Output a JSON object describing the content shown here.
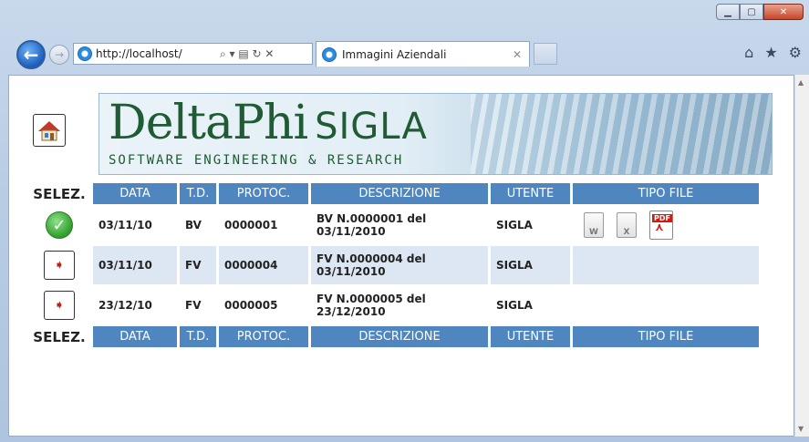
{
  "window": {
    "tab_title": "Immagini Aziendali",
    "address": "http://localhost/",
    "address_tools": "⌕ ▾ ▤ ↻ ✕"
  },
  "banner": {
    "logo_main": "DeltaPhi",
    "logo_sub": "SIGLA",
    "logo_tagline": "SOFTWARE ENGINEERING & RESEARCH"
  },
  "table": {
    "sel_header": "SELEZ.",
    "headers": [
      "DATA",
      "T.D.",
      "PROTOC.",
      "DESCRIZIONE",
      "UTENTE",
      "TIPO FILE"
    ],
    "rows": [
      {
        "data": "03/11/10",
        "td": "BV",
        "protoc": "0000001",
        "desc_line1": "BV N.0000001 del",
        "desc_line2": "03/11/2010",
        "utente": "SIGLA",
        "selected": true
      },
      {
        "data": "03/11/10",
        "td": "FV",
        "protoc": "0000004",
        "desc_line1": "FV N.0000004 del",
        "desc_line2": "03/11/2010",
        "utente": "SIGLA",
        "selected": false
      },
      {
        "data": "23/12/10",
        "td": "FV",
        "protoc": "0000005",
        "desc_line1": "FV N.0000005 del",
        "desc_line2": "23/12/2010",
        "utente": "SIGLA",
        "selected": false
      }
    ],
    "file_icons": {
      "word": "W",
      "excel": "X",
      "pdf_label": "PDF",
      "pdf_brand": "Adobe"
    }
  },
  "colors": {
    "header_bg": "#4f86c0",
    "alt_row_bg": "#dde6f3",
    "logo_green": "#1f5b33",
    "arrow_red": "#d21b10"
  }
}
